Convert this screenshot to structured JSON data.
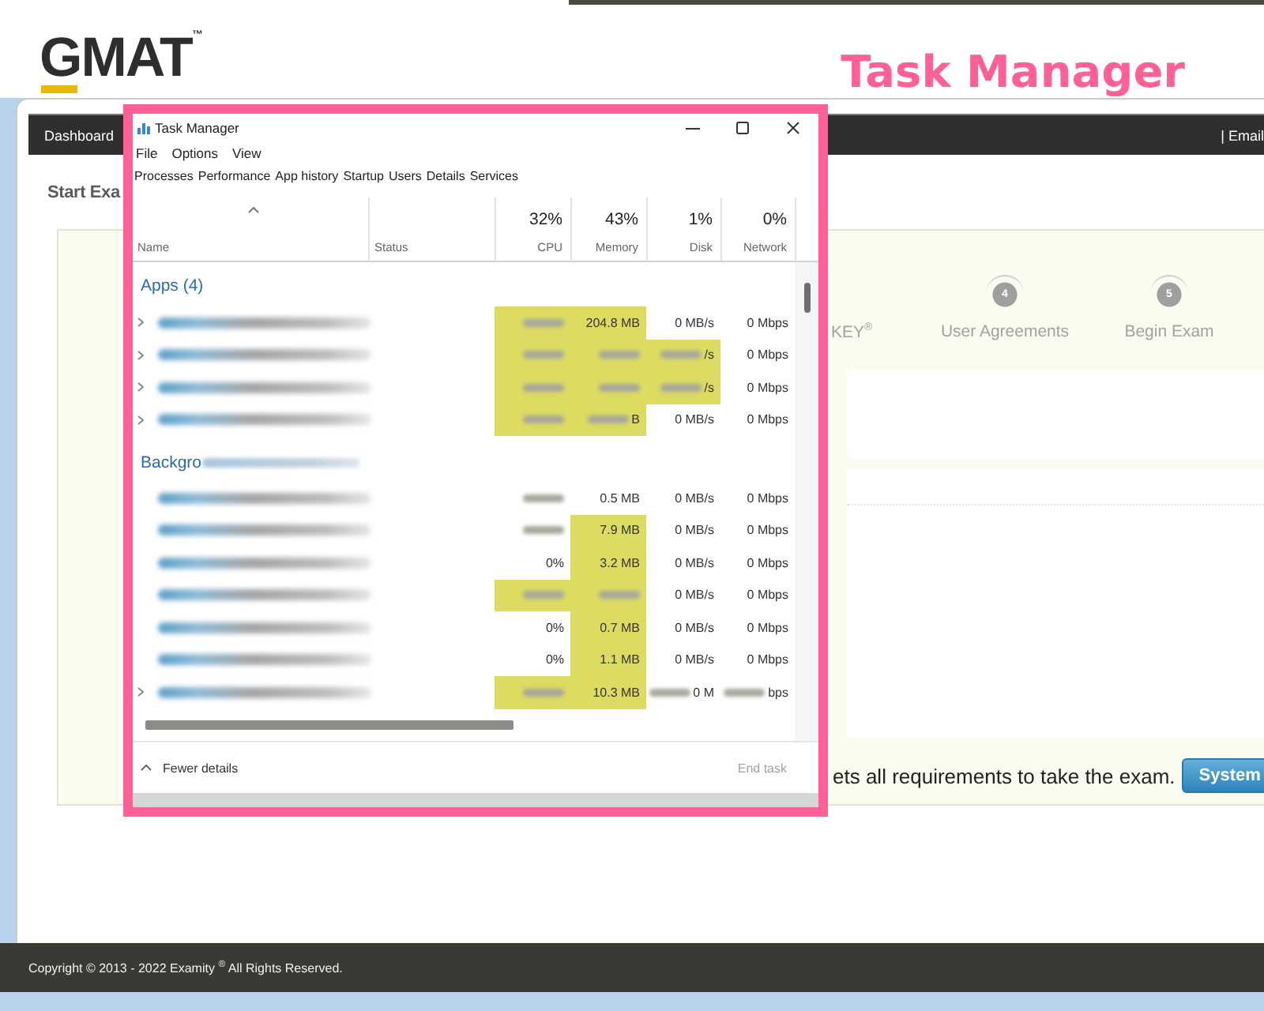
{
  "header": {
    "logo": "GMAT$^{™}$",
    "annotation": "Task Manager"
  },
  "exam_page": {
    "nav": {
      "left": "Dashboard",
      "right": "| Email"
    },
    "title": "Start Exa",
    "steps": [
      {
        "label": "KEY$^{®}$"
      },
      {
        "number": "4",
        "label": "User Agreements"
      },
      {
        "number": "5",
        "label": "Begin Exam"
      }
    ],
    "message": "ets all requirements to take the exam.",
    "button": "System"
  },
  "task_manager": {
    "title": "Task Manager",
    "menu": [
      "File",
      "Options",
      "View"
    ],
    "tabs": [
      "Processes",
      "Performance",
      "App history",
      "Startup",
      "Users",
      "Details",
      "Services"
    ],
    "columns": [
      {
        "label": "Name",
        "kind": "text",
        "sorted": true
      },
      {
        "label": "Status",
        "kind": "text",
        "sorted": false
      },
      {
        "usage": "32%",
        "label": "CPU",
        "kind": "numeric",
        "sorted": false
      },
      {
        "usage": "43%",
        "label": "Memory",
        "kind": "numeric",
        "sorted": false
      },
      {
        "usage": "1%",
        "label": "Disk",
        "kind": "numeric",
        "sorted": false
      },
      {
        "usage": "0%",
        "label": "Network",
        "kind": "numeric",
        "sorted": false
      }
    ],
    "groups": [
      {
        "heading": "Apps (4)",
        "heading_blurred": false,
        "rows": [
          {
            "expandable": true,
            "name": {
              "blurred": true
            },
            "cpu": {
              "blurred": true,
              "highlight": true
            },
            "memory": {
              "text": "204.8 MB",
              "blurred": false,
              "highlight": true
            },
            "disk": {
              "text": "0 MB/s",
              "blurred": false,
              "highlight": false
            },
            "network": {
              "text": "0 Mbps",
              "blurred": false,
              "highlight": false
            }
          },
          {
            "expandable": true,
            "name": {
              "blurred": true
            },
            "cpu": {
              "blurred": true,
              "highlight": true
            },
            "memory": {
              "blurred": true,
              "highlight": true
            },
            "disk": {
              "text": "/s",
              "blurred": true,
              "highlight": true
            },
            "network": {
              "text": "0 Mbps",
              "blurred": false,
              "highlight": false
            }
          },
          {
            "expandable": true,
            "name": {
              "blurred": true
            },
            "cpu": {
              "blurred": true,
              "highlight": true
            },
            "memory": {
              "blurred": true,
              "highlight": true
            },
            "disk": {
              "text": "/s",
              "blurred": true,
              "highlight": true
            },
            "network": {
              "text": "0 Mbps",
              "blurred": false,
              "highlight": false
            }
          },
          {
            "expandable": true,
            "name": {
              "blurred": true
            },
            "cpu": {
              "blurred": true,
              "highlight": true
            },
            "memory": {
              "text": "B",
              "blurred": true,
              "highlight": true
            },
            "disk": {
              "text": "0 MB/s",
              "blurred": false,
              "highlight": false
            },
            "network": {
              "text": "0 Mbps",
              "blurred": false,
              "highlight": false
            }
          }
        ]
      },
      {
        "heading": "Backgro",
        "heading_blurred": true,
        "rows": [
          {
            "expandable": false,
            "name": {
              "blurred": true
            },
            "cpu": {
              "blurred": true,
              "highlight": false
            },
            "memory": {
              "text": "0.5 MB",
              "blurred": false,
              "highlight": false
            },
            "disk": {
              "text": "0 MB/s",
              "blurred": false,
              "highlight": false
            },
            "network": {
              "text": "0 Mbps",
              "blurred": false,
              "highlight": false
            }
          },
          {
            "expandable": false,
            "name": {
              "blurred": true
            },
            "cpu": {
              "blurred": true,
              "highlight": false
            },
            "memory": {
              "text": "7.9 MB",
              "blurred": false,
              "highlight": true
            },
            "disk": {
              "text": "0 MB/s",
              "blurred": false,
              "highlight": false
            },
            "network": {
              "text": "0 Mbps",
              "blurred": false,
              "highlight": false
            }
          },
          {
            "expandable": false,
            "name": {
              "blurred": true
            },
            "cpu": {
              "text": "0%",
              "blurred": false,
              "highlight": false
            },
            "memory": {
              "text": "3.2 MB",
              "blurred": false,
              "highlight": true
            },
            "disk": {
              "text": "0 MB/s",
              "blurred": false,
              "highlight": false
            },
            "network": {
              "text": "0 Mbps",
              "blurred": false,
              "highlight": false
            }
          },
          {
            "expandable": false,
            "name": {
              "blurred": true
            },
            "cpu": {
              "blurred": true,
              "highlight": true
            },
            "memory": {
              "blurred": true,
              "highlight": true
            },
            "disk": {
              "text": "0 MB/s",
              "blurred": false,
              "highlight": false
            },
            "network": {
              "text": "0 Mbps",
              "blurred": false,
              "highlight": false
            }
          },
          {
            "expandable": false,
            "name": {
              "blurred": true
            },
            "cpu": {
              "text": "0%",
              "blurred": false,
              "highlight": false
            },
            "memory": {
              "text": "0.7 MB",
              "blurred": false,
              "highlight": true
            },
            "disk": {
              "text": "0 MB/s",
              "blurred": false,
              "highlight": false
            },
            "network": {
              "text": "0 Mbps",
              "blurred": false,
              "highlight": false
            }
          },
          {
            "expandable": false,
            "name": {
              "blurred": true
            },
            "cpu": {
              "text": "0%",
              "blurred": false,
              "highlight": false
            },
            "memory": {
              "text": "1.1 MB",
              "blurred": false,
              "highlight": true
            },
            "disk": {
              "text": "0 MB/s",
              "blurred": false,
              "highlight": false
            },
            "network": {
              "text": "0 Mbps",
              "blurred": false,
              "highlight": false
            }
          },
          {
            "expandable": true,
            "name": {
              "blurred": true
            },
            "cpu": {
              "blurred": true,
              "highlight": true
            },
            "memory": {
              "text": "10.3 MB",
              "blurred": false,
              "highlight": true
            },
            "disk": {
              "text": "0 M",
              "blurred": true,
              "highlight": false
            },
            "network": {
              "text": "bps",
              "blurred": true,
              "highlight": false
            }
          }
        ]
      }
    ],
    "footer": {
      "toggle": "Fewer details",
      "end_task": {
        "label": "End task",
        "disabled": true
      }
    }
  },
  "footer": {
    "copyright": "Copyright © 2013 - 2022 Examity $^{®}$ All Rights Reserved."
  }
}
